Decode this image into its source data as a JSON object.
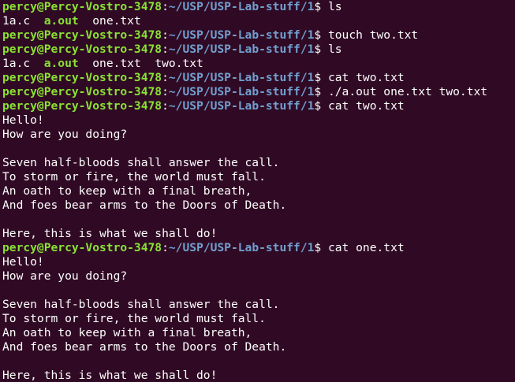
{
  "terminal": {
    "prompt": {
      "user_host": "percy@Percy-Vostro-3478",
      "colon": ":",
      "path": "~/USP/USP-Lab-stuff/1",
      "symbol": "$"
    },
    "lines": [
      {
        "type": "prompt",
        "command": " ls"
      },
      {
        "type": "listing",
        "items": [
          {
            "text": "1a.c",
            "kind": "file"
          },
          {
            "text": "  ",
            "kind": "space"
          },
          {
            "text": "a.out",
            "kind": "exe"
          },
          {
            "text": "  ",
            "kind": "space"
          },
          {
            "text": "one.txt",
            "kind": "file"
          }
        ]
      },
      {
        "type": "prompt",
        "command": " touch two.txt"
      },
      {
        "type": "prompt",
        "command": " ls"
      },
      {
        "type": "listing",
        "items": [
          {
            "text": "1a.c",
            "kind": "file"
          },
          {
            "text": "  ",
            "kind": "space"
          },
          {
            "text": "a.out",
            "kind": "exe"
          },
          {
            "text": "  ",
            "kind": "space"
          },
          {
            "text": "one.txt",
            "kind": "file"
          },
          {
            "text": "  ",
            "kind": "space"
          },
          {
            "text": "two.txt",
            "kind": "file"
          }
        ]
      },
      {
        "type": "prompt",
        "command": " cat two.txt"
      },
      {
        "type": "prompt",
        "command": " ./a.out one.txt two.txt"
      },
      {
        "type": "prompt",
        "command": " cat two.txt"
      },
      {
        "type": "output",
        "text": "Hello!"
      },
      {
        "type": "output",
        "text": "How are you doing?"
      },
      {
        "type": "output",
        "text": ""
      },
      {
        "type": "output",
        "text": "Seven half-bloods shall answer the call."
      },
      {
        "type": "output",
        "text": "To storm or fire, the world must fall."
      },
      {
        "type": "output",
        "text": "An oath to keep with a final breath,"
      },
      {
        "type": "output",
        "text": "And foes bear arms to the Doors of Death."
      },
      {
        "type": "output",
        "text": ""
      },
      {
        "type": "output",
        "text": "Here, this is what we shall do!"
      },
      {
        "type": "prompt",
        "command": " cat one.txt"
      },
      {
        "type": "output",
        "text": "Hello!"
      },
      {
        "type": "output",
        "text": "How are you doing?"
      },
      {
        "type": "output",
        "text": ""
      },
      {
        "type": "output",
        "text": "Seven half-bloods shall answer the call."
      },
      {
        "type": "output",
        "text": "To storm or fire, the world must fall."
      },
      {
        "type": "output",
        "text": "An oath to keep with a final breath,"
      },
      {
        "type": "output",
        "text": "And foes bear arms to the Doors of Death."
      },
      {
        "type": "output",
        "text": ""
      },
      {
        "type": "output",
        "text": "Here, this is what we shall do!"
      }
    ]
  },
  "colors": {
    "background": "#300a24",
    "prompt_user": "#8ae234",
    "prompt_path": "#729fcf",
    "text": "#ffffff",
    "executable": "#8ae234"
  }
}
